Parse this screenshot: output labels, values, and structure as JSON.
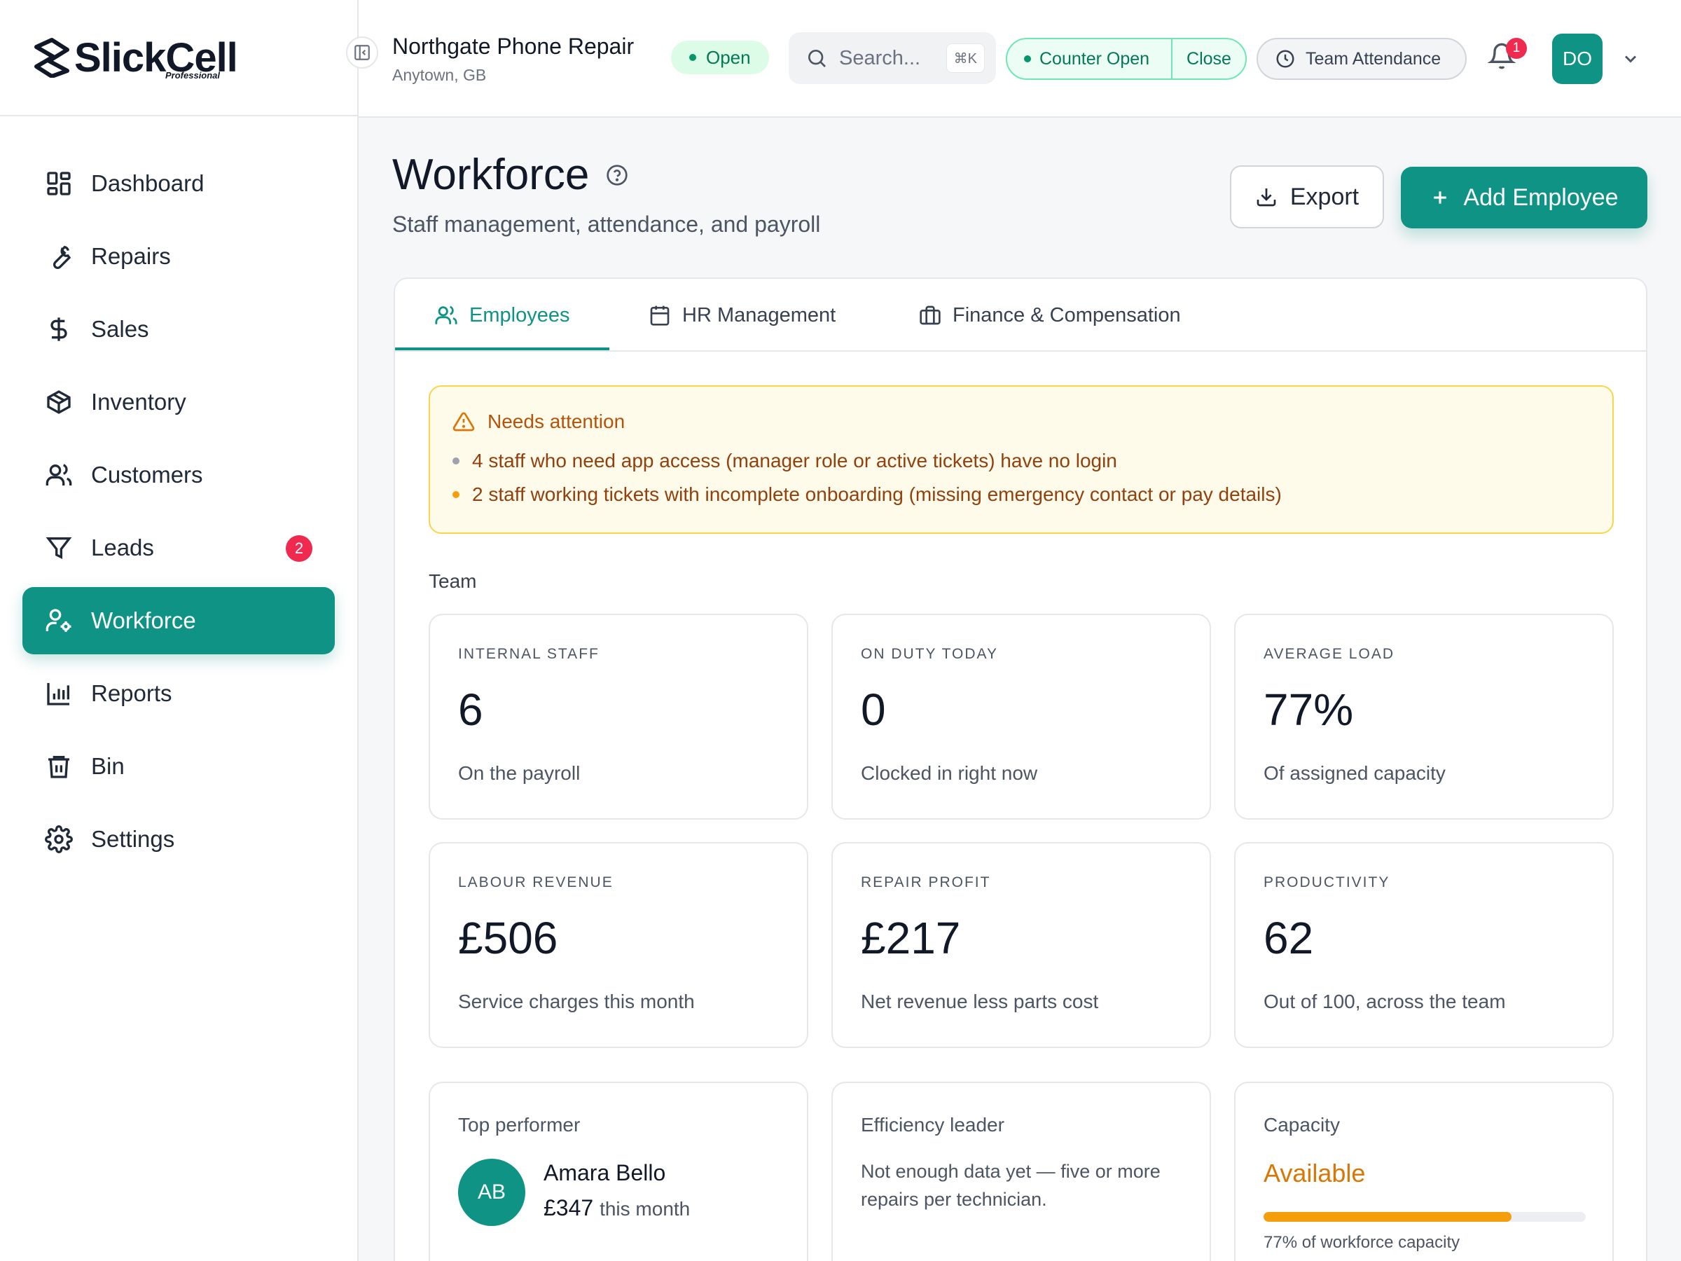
{
  "brand": {
    "name": "SlickCell",
    "tier": "Professional"
  },
  "sidebar": {
    "items": [
      {
        "label": "Dashboard"
      },
      {
        "label": "Repairs"
      },
      {
        "label": "Sales"
      },
      {
        "label": "Inventory"
      },
      {
        "label": "Customers"
      },
      {
        "label": "Leads",
        "badge": "2"
      },
      {
        "label": "Workforce",
        "active": true
      },
      {
        "label": "Reports"
      },
      {
        "label": "Bin"
      },
      {
        "label": "Settings"
      }
    ]
  },
  "topbar": {
    "shop_name": "Northgate Phone Repair",
    "shop_location": "Anytown, GB",
    "status": "Open",
    "search_placeholder": "Search...",
    "search_shortcut": "⌘K",
    "counter_status": "Counter Open",
    "counter_action": "Close",
    "attendance_label": "Team Attendance",
    "notifications_count": "1",
    "user_initials": "DO"
  },
  "header": {
    "title": "Workforce",
    "subtitle": "Staff management, attendance, and payroll",
    "export_label": "Export",
    "add_label": "Add Employee"
  },
  "tabs": [
    {
      "label": "Employees",
      "active": true
    },
    {
      "label": "HR Management"
    },
    {
      "label": "Finance & Compensation"
    }
  ],
  "alert": {
    "title": "Needs attention",
    "items": [
      {
        "text": "4 staff who need app access (manager role or active tickets) have no login",
        "color": "#9ca3af"
      },
      {
        "text": "2 staff working tickets with incomplete onboarding (missing emergency contact or pay details)",
        "color": "#f59e0b"
      }
    ]
  },
  "team": {
    "label": "Team",
    "stats": [
      {
        "label": "INTERNAL STAFF",
        "value": "6",
        "sub": "On the payroll"
      },
      {
        "label": "ON DUTY TODAY",
        "value": "0",
        "sub": "Clocked in right now"
      },
      {
        "label": "AVERAGE LOAD",
        "value": "77%",
        "sub": "Of assigned capacity"
      },
      {
        "label": "LABOUR REVENUE",
        "value": "£506",
        "sub": "Service charges this month"
      },
      {
        "label": "REPAIR PROFIT",
        "value": "£217",
        "sub": "Net revenue less parts cost"
      },
      {
        "label": "PRODUCTIVITY",
        "value": "62",
        "sub": "Out of 100, across the team"
      }
    ],
    "top_performer": {
      "title": "Top performer",
      "initials": "AB",
      "name": "Amara Bello",
      "amount": "£347",
      "period": "this month"
    },
    "efficiency": {
      "title": "Efficiency leader",
      "text": "Not enough data yet — five or more repairs per technician."
    },
    "capacity": {
      "title": "Capacity",
      "status": "Available",
      "percent": 77,
      "note": "77% of workforce capacity"
    }
  },
  "colors": {
    "accent": "#0e9384",
    "warning": "#d97706",
    "danger": "#f0294f"
  }
}
